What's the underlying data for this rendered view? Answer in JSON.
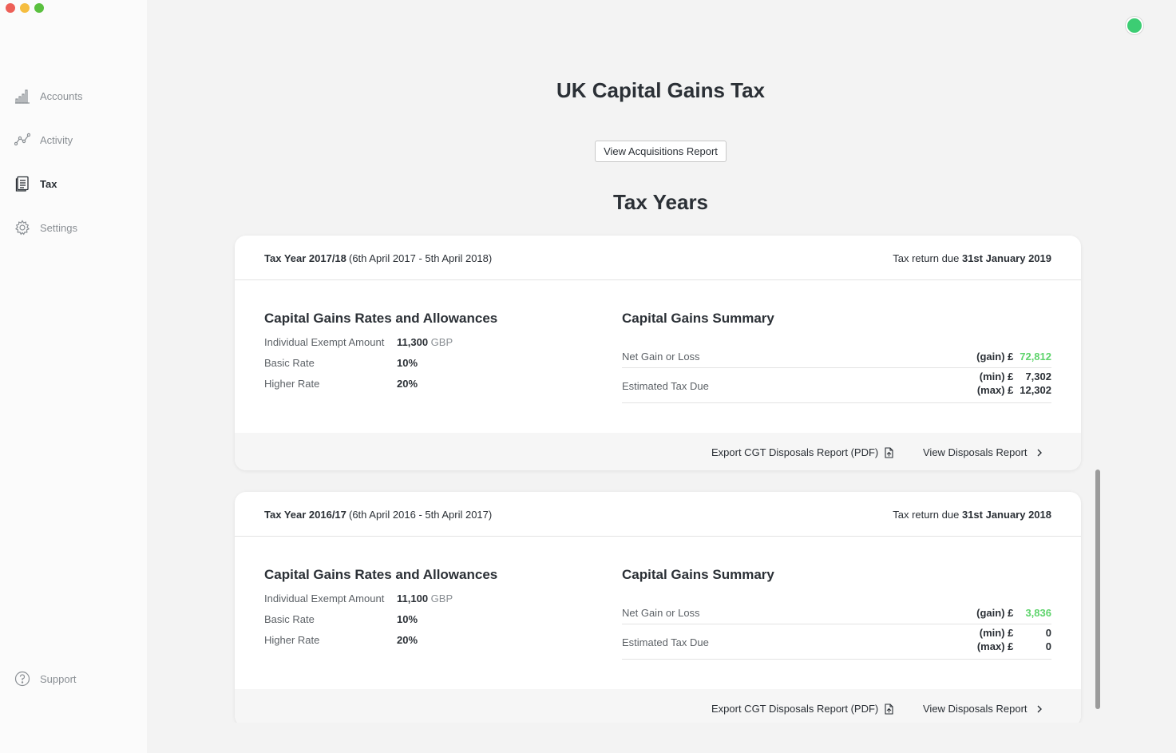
{
  "sidebar": {
    "items": [
      {
        "label": "Accounts"
      },
      {
        "label": "Activity"
      },
      {
        "label": "Tax"
      },
      {
        "label": "Settings"
      }
    ],
    "support": {
      "label": "Support"
    }
  },
  "header": {
    "title": "UK Capital Gains Tax",
    "acquisitions_button": "View Acquisitions Report",
    "section_title": "Tax Years"
  },
  "tax_years": [
    {
      "name": "Tax Year 2017/18",
      "range": "(6th April 2017 - 5th April 2018)",
      "due_prefix": "Tax return due",
      "due_date": "31st January 2019",
      "rates_title": "Capital Gains Rates and Allowances",
      "rates": [
        {
          "label": "Individual Exempt Amount",
          "value": "11,300",
          "unit": "GBP"
        },
        {
          "label": "Basic Rate",
          "value": "10%",
          "unit": ""
        },
        {
          "label": "Higher Rate",
          "value": "20%",
          "unit": ""
        }
      ],
      "summary_title": "Capital Gains Summary",
      "net_label": "Net Gain or Loss",
      "net_qualifier": "(gain) £",
      "net_value": "72,812",
      "tax_label": "Estimated Tax Due",
      "tax_min_qualifier": "(min) £",
      "tax_min": "7,302",
      "tax_max_qualifier": "(max) £",
      "tax_max": "12,302",
      "export_label": "Export CGT Disposals Report (PDF)",
      "view_label": "View Disposals Report"
    },
    {
      "name": "Tax Year 2016/17",
      "range": "(6th April 2016 - 5th April 2017)",
      "due_prefix": "Tax return due",
      "due_date": "31st January 2018",
      "rates_title": "Capital Gains Rates and Allowances",
      "rates": [
        {
          "label": "Individual Exempt Amount",
          "value": "11,100",
          "unit": "GBP"
        },
        {
          "label": "Basic Rate",
          "value": "10%",
          "unit": ""
        },
        {
          "label": "Higher Rate",
          "value": "20%",
          "unit": ""
        }
      ],
      "summary_title": "Capital Gains Summary",
      "net_label": "Net Gain or Loss",
      "net_qualifier": "(gain) £",
      "net_value": "3,836",
      "tax_label": "Estimated Tax Due",
      "tax_min_qualifier": "(min) £",
      "tax_min": "0",
      "tax_max_qualifier": "(max) £",
      "tax_max": "0",
      "export_label": "Export CGT Disposals Report (PDF)",
      "view_label": "View Disposals Report"
    }
  ],
  "colors": {
    "gain_green": "#5ed46c",
    "status_dot": "#3ccd73"
  },
  "icons": {
    "accounts": "bar-chart-icon",
    "activity": "line-chart-icon",
    "tax": "document-icon",
    "settings": "gear-icon",
    "support": "question-icon",
    "export": "pdf-export-icon",
    "view": "chevron-right-icon"
  }
}
